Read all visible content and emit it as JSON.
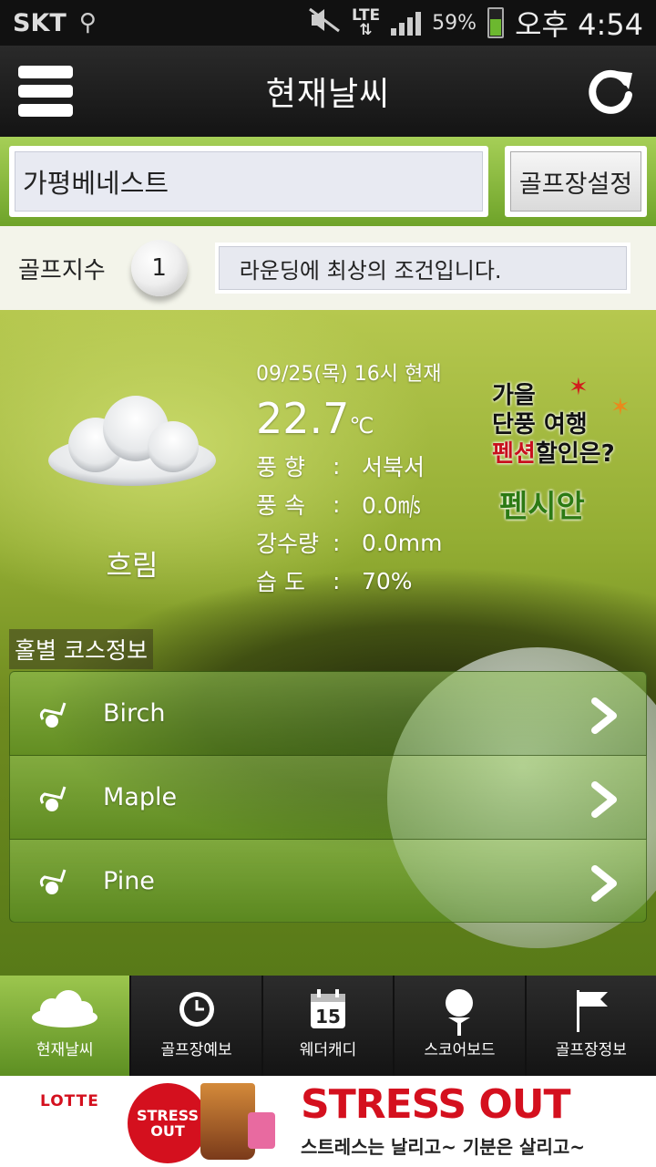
{
  "status_bar": {
    "carrier": "SKT",
    "network": "LTE",
    "battery_percent": "59%",
    "time": "오후 4:54"
  },
  "header": {
    "title": "현재날씨"
  },
  "course": {
    "name": "가평베네스트",
    "set_button": "골프장설정"
  },
  "golf_index": {
    "label": "골프지수",
    "value": "1",
    "message": "라운딩에 최상의 조건입니다."
  },
  "weather": {
    "condition": "흐림",
    "datetime": "09/25(목) 16시 현재",
    "temperature": "22.7",
    "temp_unit": "℃",
    "details": [
      {
        "key": "풍  향",
        "value": "서북서"
      },
      {
        "key": "풍  속",
        "value": "0.0㎧"
      },
      {
        "key": "강수량",
        "value": "0.0mm"
      },
      {
        "key": "습  도",
        "value": "70%"
      }
    ]
  },
  "promo": {
    "line1": "가을",
    "line2": "단풍 여행",
    "line3_red": "펜션",
    "line3_rest": "할인은?",
    "brand": "펜시안"
  },
  "holes": {
    "header": "홀별 코스정보",
    "items": [
      "Birch",
      "Maple",
      "Pine"
    ]
  },
  "tabs": [
    {
      "label": "현재날씨",
      "icon": "cloud-icon",
      "active": true
    },
    {
      "label": "골프장예보",
      "icon": "clock-icon",
      "active": false
    },
    {
      "label": "웨더캐디",
      "icon": "calendar-icon",
      "active": false
    },
    {
      "label": "스코어보드",
      "icon": "golf-tee-icon",
      "active": false
    },
    {
      "label": "골프장정보",
      "icon": "flag-icon",
      "active": false
    }
  ],
  "ad_banner": {
    "brand": "LOTTE",
    "badge": "STRESS OUT",
    "title": "STRESS OUT",
    "subtitle": "스트레스는 날리고~ 기분은 살리고~"
  },
  "colors": {
    "accent_green": "#6ea329",
    "promo_red": "#c8101e",
    "ad_red": "#d4101e"
  }
}
